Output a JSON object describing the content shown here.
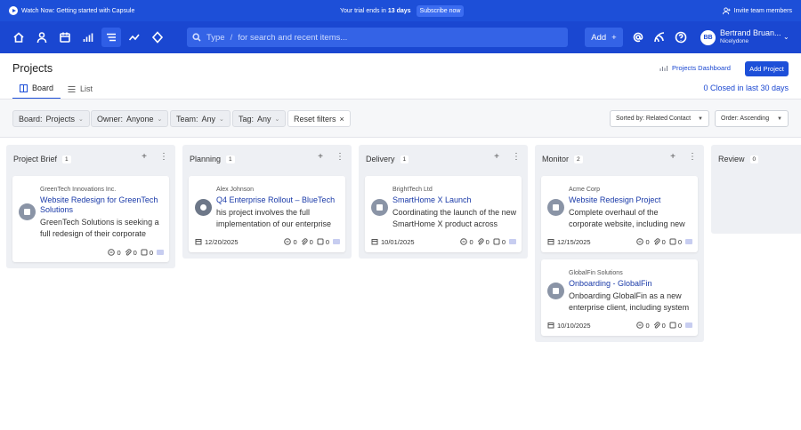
{
  "banner": {
    "watch_text": "Watch Now: Getting started with Capsule",
    "trial_prefix": "Your trial ends in",
    "trial_days": "13 days",
    "subscribe": "Subscribe now",
    "invite": "Invite team members"
  },
  "nav": {
    "search_type": "Type",
    "search_slash": "/",
    "search_placeholder": "for search and recent items...",
    "add_label": "Add",
    "user_initials": "BB",
    "user_name": "Bertrand Bruan...",
    "user_org": "Nicelydone"
  },
  "page": {
    "title": "Projects",
    "dashboard_link": "Projects Dashboard",
    "add_project": "Add Project",
    "tab_board": "Board",
    "tab_list": "List",
    "closed_summary": "0 Closed in last 30 days"
  },
  "filters": {
    "board_label": "Board:",
    "board_value": "Projects",
    "owner_label": "Owner:",
    "owner_value": "Anyone",
    "team_label": "Team:",
    "team_value": "Any",
    "tag_label": "Tag:",
    "tag_value": "Any",
    "reset": "Reset filters",
    "sort": "Sorted by: Related Contact",
    "order": "Order: Ascending"
  },
  "columns": [
    {
      "name": "Project Brief",
      "count": "1"
    },
    {
      "name": "Planning",
      "count": "1"
    },
    {
      "name": "Delivery",
      "count": "1"
    },
    {
      "name": "Monitor",
      "count": "2"
    },
    {
      "name": "Review",
      "count": "0"
    }
  ],
  "cards": [
    {
      "company": "GreenTech Innovations Inc.",
      "title": "Website Redesign for GreenTech Solutions",
      "desc": "GreenTech Solutions is seeking a full redesign of their corporate website",
      "date": "",
      "tasks": "0",
      "files": "0",
      "notes": "0"
    },
    {
      "company": "Alex Johnson",
      "title": "Q4 Enterprise Rollout – BlueTech",
      "desc": "his project involves the full implementation of our enterprise",
      "date": "12/20/2025",
      "tasks": "0",
      "files": "0",
      "notes": "0"
    },
    {
      "company": "BrightTech Ltd",
      "title": "SmartHome X Launch",
      "desc": "Coordinating the launch of the new SmartHome X product across",
      "date": "10/01/2025",
      "tasks": "0",
      "files": "0",
      "notes": "0"
    },
    {
      "company": "Acme Corp",
      "title": "Website Redesign Project",
      "desc": "Complete overhaul of the corporate website, including new",
      "date": "12/15/2025",
      "tasks": "0",
      "files": "0",
      "notes": "0"
    },
    {
      "company": "GlobalFin Solutions",
      "title": "Onboarding - GlobalFin",
      "desc": "Onboarding GlobalFin as a new enterprise client, including system",
      "date": "10/10/2025",
      "tasks": "0",
      "files": "0",
      "notes": "0"
    }
  ],
  "colors": {
    "brand": "#1d4fd8",
    "nav": "#1a47d1",
    "link": "#1a3aa8"
  }
}
